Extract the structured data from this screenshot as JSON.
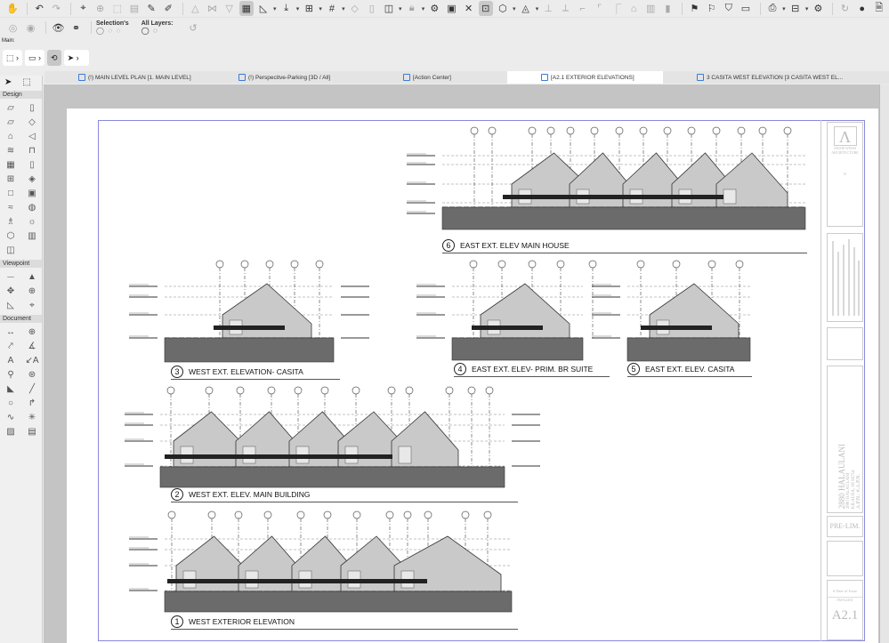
{
  "toolbar": {
    "selections_label": "Selection's",
    "all_layers_label": "All Layers:",
    "main_label": "Main:"
  },
  "tabs": [
    {
      "label": "(!) MAIN LEVEL PLAN [1. MAIN LEVEL]",
      "active": false
    },
    {
      "label": "(!) Perspecitve-Parking [3D / All]",
      "active": false
    },
    {
      "label": "[Action Center]",
      "active": false
    },
    {
      "label": "[A2.1 EXTERIOR ELEVATIONS]",
      "active": true
    },
    {
      "label": "3 CASITA WEST ELEVATION [3 CASITA WEST EL...",
      "active": false
    }
  ],
  "palette": {
    "design": "Design",
    "viewpoint": "Viewpoint",
    "document": "Document"
  },
  "drawings": [
    {
      "num": "6",
      "title": "EAST EXT. ELEV MAIN HOUSE"
    },
    {
      "num": "3",
      "title": "WEST EXT. ELEVATION- CASITA"
    },
    {
      "num": "4",
      "title": "EAST EXT. ELEV- PRIM. BR SUITE"
    },
    {
      "num": "5",
      "title": "EAST EXT. ELEV. CASITA"
    },
    {
      "num": "2",
      "title": "WEST EXT. ELEV. MAIN BUILDING"
    },
    {
      "num": "1",
      "title": "WEST EXTERIOR ELEVATION"
    }
  ],
  "title_block": {
    "firm": "ADAM WEISS ARCHITECTURE",
    "project": "2880 HALAULANI",
    "address1": "2880 HALAULANI",
    "address2": "KILAUEA, HI 96754",
    "apn": "A.P.N.: #.A.P.N.",
    "status": "PRE-LIM.",
    "date_label": "# Date of Issue",
    "job": "AWA2201",
    "sheet": "A2.1"
  },
  "colors": {
    "accent": "#3a7bd5",
    "frame": "#8888dd",
    "ground": "#6b6b6b"
  }
}
